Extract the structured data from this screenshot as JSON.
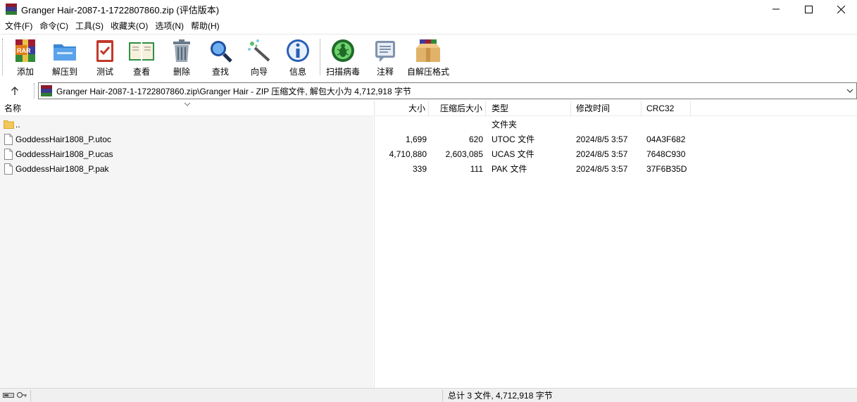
{
  "window": {
    "title": "Granger Hair-2087-1-1722807860.zip (评估版本)",
    "controls": [
      "minimize-icon",
      "maximize-icon",
      "close-icon"
    ]
  },
  "menu": {
    "items": [
      "文件(F)",
      "命令(C)",
      "工具(S)",
      "收藏夹(O)",
      "选项(N)",
      "帮助(H)"
    ]
  },
  "toolbar": {
    "buttons": [
      {
        "label": "添加",
        "icon": "add-archive-icon"
      },
      {
        "label": "解压到",
        "icon": "extract-folder-icon"
      },
      {
        "label": "测试",
        "icon": "test-clipboard-icon"
      },
      {
        "label": "查看",
        "icon": "view-book-icon"
      },
      {
        "label": "删除",
        "icon": "trash-bin-icon"
      },
      {
        "label": "查找",
        "icon": "magnifier-icon"
      },
      {
        "label": "向导",
        "icon": "wizard-wand-icon"
      },
      {
        "label": "信息",
        "icon": "info-icon"
      },
      {
        "label": "扫描病毒",
        "icon": "virus-scan-icon"
      },
      {
        "label": "注释",
        "icon": "comment-icon"
      },
      {
        "label": "自解压格式",
        "icon": "sfx-box-icon"
      }
    ]
  },
  "address": {
    "path": "Granger Hair-2087-1-1722807860.zip\\Granger Hair - ZIP 压缩文件, 解包大小为 4,712,918 字节"
  },
  "columns": {
    "name": "名称",
    "size": "大小",
    "packed": "压缩后大小",
    "type": "类型",
    "modified": "修改时间",
    "crc": "CRC32"
  },
  "files": [
    {
      "name": "..",
      "size": "",
      "packed": "",
      "type": "文件夹",
      "modified": "",
      "crc": "",
      "kind": "folder"
    },
    {
      "name": "GoddessHair1808_P.utoc",
      "size": "1,699",
      "packed": "620",
      "type": "UTOC 文件",
      "modified": "2024/8/5 3:57",
      "crc": "04A3F682",
      "kind": "file"
    },
    {
      "name": "GoddessHair1808_P.ucas",
      "size": "4,710,880",
      "packed": "2,603,085",
      "type": "UCAS 文件",
      "modified": "2024/8/5 3:57",
      "crc": "7648C930",
      "kind": "file"
    },
    {
      "name": "GoddessHair1808_P.pak",
      "size": "339",
      "packed": "111",
      "type": "PAK 文件",
      "modified": "2024/8/5 3:57",
      "crc": "37F6B35D",
      "kind": "file"
    }
  ],
  "status": {
    "summary": "总计 3 文件, 4,712,918 字节"
  }
}
